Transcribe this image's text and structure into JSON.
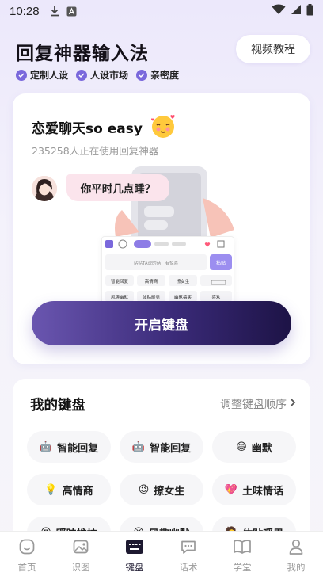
{
  "status_bar": {
    "time": "10:28"
  },
  "header": {
    "title": "回复神器输入法",
    "tags": [
      "定制人设",
      "人设市场",
      "亲密度"
    ],
    "tutorial_label": "视频教程"
  },
  "hero": {
    "title": "恋爱聊天so easy",
    "subtitle": "235258人正在使用回复神器",
    "bubble_text": "你平时几点睡？",
    "keyboard_preview": {
      "input_hint": "粘贴TA说的话，有惊喜",
      "paste_label": "粘贴",
      "keys": [
        "智能回复",
        "高情商",
        "撩女生",
        "风趣幽默",
        "体贴暖男",
        "幽默搞笑",
        "喜欢"
      ]
    },
    "start_label": "开启键盘"
  },
  "my_keyboard": {
    "title": "我的键盘",
    "order_label": "调整键盘顺序",
    "chips": [
      {
        "icon": "🤖",
        "label": "智能回复"
      },
      {
        "icon": "🤖",
        "label": "智能回复"
      },
      {
        "icon": "😄",
        "label": "幽默"
      },
      {
        "icon": "💡",
        "label": "高情商"
      },
      {
        "icon": "😉",
        "label": "撩女生"
      },
      {
        "icon": "💖",
        "label": "土味情话"
      },
      {
        "icon": "😍",
        "label": "暧昧推拉"
      },
      {
        "icon": "😆",
        "label": "风趣幽默"
      },
      {
        "icon": "🧔",
        "label": "体贴暖男"
      }
    ]
  },
  "nav": {
    "items": [
      {
        "label": "首页",
        "icon": "home-icon"
      },
      {
        "label": "识图",
        "icon": "image-icon"
      },
      {
        "label": "键盘",
        "icon": "keyboard-icon"
      },
      {
        "label": "话术",
        "icon": "chat-icon"
      },
      {
        "label": "学堂",
        "icon": "book-icon"
      },
      {
        "label": "我的",
        "icon": "user-icon"
      }
    ],
    "active_index": 2
  },
  "colors": {
    "accent": "#7a68dc",
    "button_dark": "#2a1d5c",
    "bubble": "#fbe4ec"
  }
}
